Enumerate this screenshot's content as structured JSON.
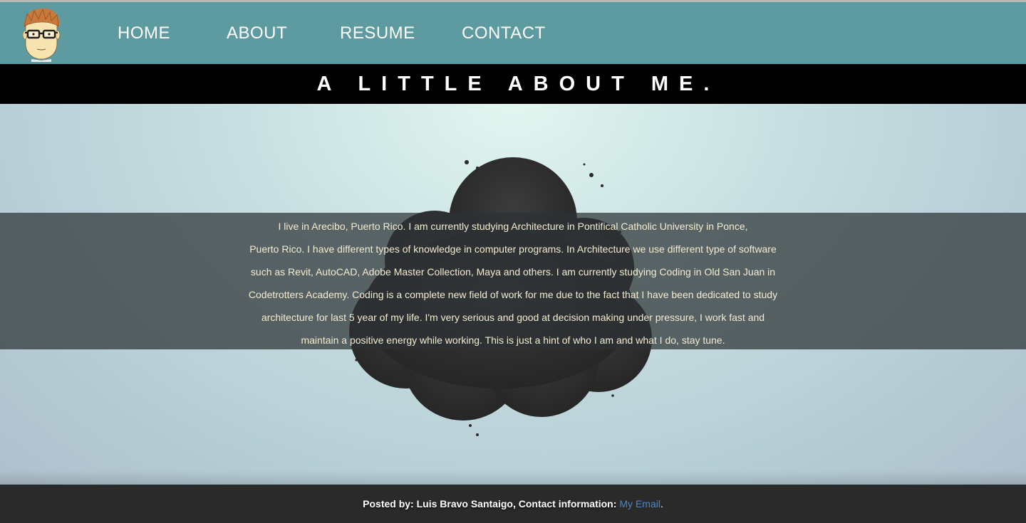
{
  "nav": {
    "items": [
      {
        "label": "HOME"
      },
      {
        "label": "ABOUT"
      },
      {
        "label": "RESUME"
      },
      {
        "label": "CONTACT"
      }
    ]
  },
  "title": "A LITTLE ABOUT ME.",
  "about": {
    "lines": [
      "I live in Arecibo, Puerto Rico. I am currently studying Architecture in Pontifical Catholic University in Ponce,",
      "Puerto Rico. I have different types of knowledge in computer programs. In Architecture we use different type of software",
      "such as Revit, AutoCAD, Adobe Master Collection, Maya and others. I am currently studying Coding in Old San Juan in",
      "Codetrotters Academy. Coding is a complete new field of work for me due to the fact that I have been dedicated to study",
      "architecture for last 5 year of my life. I'm very serious and good at decision making under pressure, I work fast and",
      "maintain a positive energy while working. This is just a hint of who I am and what I do, stay tune."
    ]
  },
  "footer": {
    "posted_text": "Posted by: Luis Bravo Santaigo, Contact information:",
    "link_text": "My Email",
    "trailing": "."
  },
  "colors": {
    "navbar": "#5e9ba1",
    "title_band": "#000000",
    "footer": "#2a2a2a",
    "link": "#4c86c6",
    "body_text": "#f2ecd0"
  },
  "icons": {
    "avatar": "cartoon-face-with-glasses",
    "hero_graphic": "ink-cloud"
  }
}
